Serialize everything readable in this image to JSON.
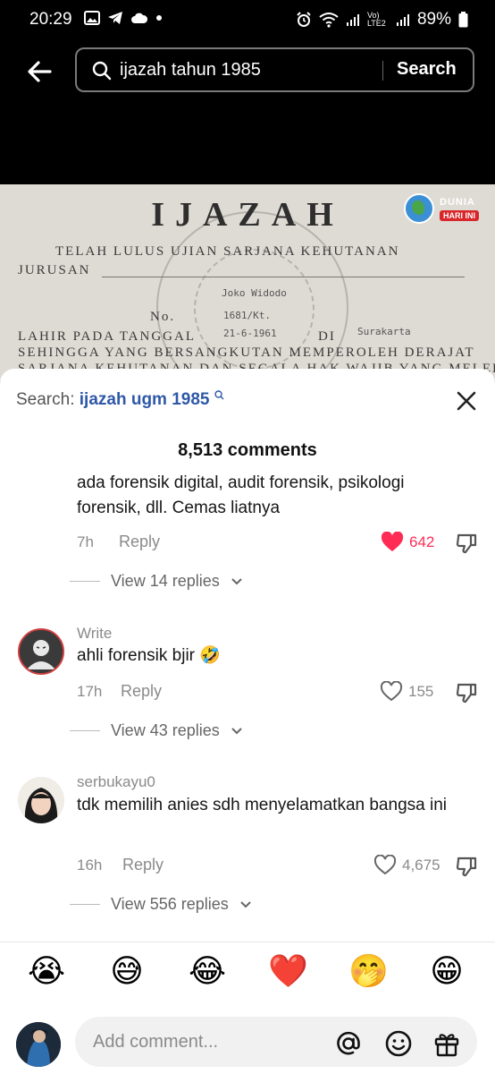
{
  "status_bar": {
    "time": "20:29",
    "lte_label": "Vo) LTE2",
    "battery": "89%"
  },
  "search": {
    "query": "ijazah tahun 1985",
    "button_label": "Search"
  },
  "video_document": {
    "title": "IJAZAH",
    "line1": "TELAH   LULUS   UJIAN   SARJANA   KEHUTANAN",
    "line2": "JURUSAN",
    "handwritten_name": "Joko Widodo",
    "no_label": "No.",
    "handwritten_no": "1681/Kt.",
    "line3": "LAHIR PADA TANGGAL",
    "handwritten_date": "21-6-1961",
    "di_label": "DI",
    "handwritten_place": "Surakarta",
    "line4": "SEHINGGA  YANG  BERSANGKUTAN  MEMPEROLEH  DERAJAT",
    "line5": "SARJANA  KEHUTANAN  DAN  SEGALA  HAK  WAJIB  YANG  MELEKAT"
  },
  "watermark_logo": {
    "line1": "DUNIA",
    "line2": "HARI INI"
  },
  "panel": {
    "search_label": "Search:",
    "search_query": "ijazah ugm 1985",
    "comment_count": "8,513 comments"
  },
  "comments": [
    {
      "text": "ada forensik digital, audit forensik, psikologi forensik, dll. Cemas liatnya",
      "time": "7h",
      "reply_label": "Reply",
      "likes": "642",
      "liked": true,
      "view_replies": "View 14 replies"
    },
    {
      "user": "Write",
      "text": "ahli forensik bjir 🤣",
      "time": "17h",
      "reply_label": "Reply",
      "likes": "155",
      "liked": false,
      "view_replies": "View 43 replies"
    },
    {
      "user": "serbukayu0",
      "text": "tdk memilih anies sdh menyelamatkan bangsa ini",
      "time": "16h",
      "reply_label": "Reply",
      "likes": "4,675",
      "liked": false,
      "view_replies": "View 556 replies"
    }
  ],
  "emojis": [
    "😭",
    "😅",
    "😂",
    "❤️",
    "🤭",
    "😁"
  ],
  "input": {
    "placeholder": "Add comment..."
  },
  "colors": {
    "like_red": "#fe2c55",
    "link_blue": "#2f58a8",
    "muted": "#8a8a8a"
  }
}
